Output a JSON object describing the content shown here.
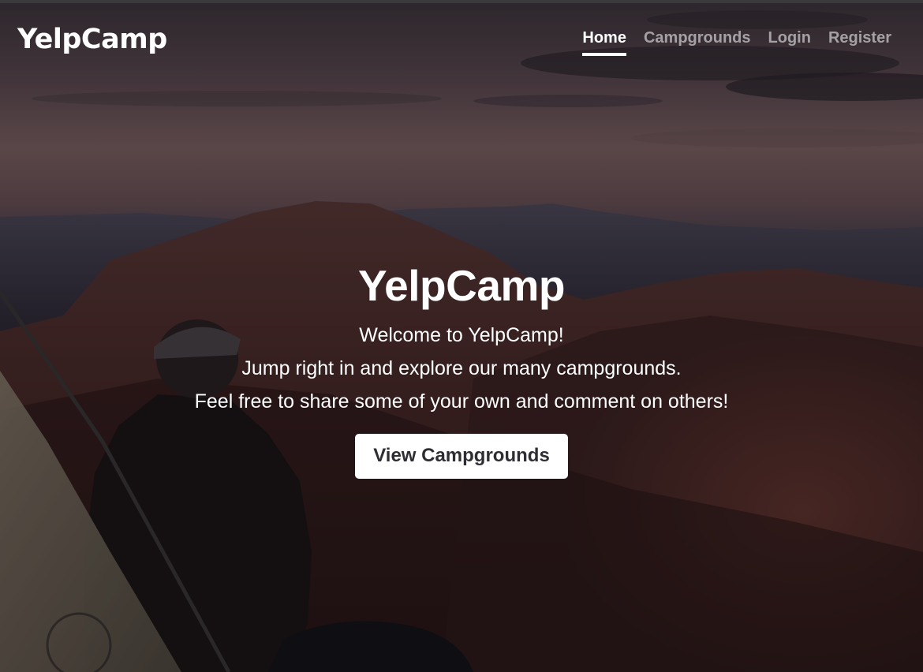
{
  "navbar": {
    "brand": "YelpCamp",
    "links": [
      {
        "label": "Home",
        "active": true
      },
      {
        "label": "Campgrounds",
        "active": false
      },
      {
        "label": "Login",
        "active": false
      },
      {
        "label": "Register",
        "active": false
      }
    ]
  },
  "hero": {
    "title": "YelpCamp",
    "lines": [
      "Welcome to YelpCamp!",
      "Jump right in and explore our many campgrounds.",
      "Feel free to share some of your own and comment on others!"
    ],
    "button_label": "View Campgrounds"
  },
  "colors": {
    "sky_top": "#4a3d45",
    "sky_horizon": "#8a6a6a",
    "mountain": "#4a2a2c",
    "button_bg": "#ffffff",
    "button_text": "#2d2d33"
  }
}
